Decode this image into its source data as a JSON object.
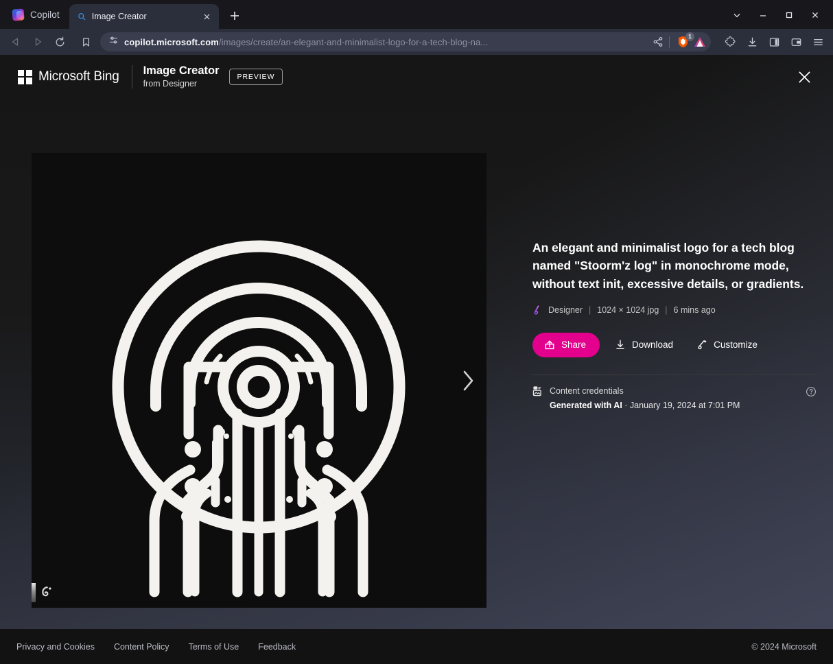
{
  "browser": {
    "brand_tab_label": "Copilot",
    "brand_tab_icon": "copilot-icon",
    "tab": {
      "title": "Image Creator",
      "favicon": "search-icon",
      "close_icon": "close-icon"
    },
    "new_tab_icon": "plus-icon",
    "window_controls": {
      "tab_search_icon": "chevron-down-icon",
      "minimize_icon": "minimize-icon",
      "maximize_icon": "maximize-icon",
      "close_icon": "close-icon"
    },
    "nav": {
      "back_icon": "back-arrow-icon",
      "forward_icon": "forward-arrow-icon",
      "reload_icon": "reload-icon",
      "bookmark_icon": "bookmark-icon"
    },
    "omnibox": {
      "site_settings_icon": "site-settings-icon",
      "url_domain": "copilot.microsoft.com",
      "url_path": "/images/create/an-elegant-and-minimalist-logo-for-a-tech-blog-na...",
      "share_icon": "share-icon",
      "shields_icon": "brave-shields-lion-icon",
      "shields_badge": "1",
      "leo_icon": "brave-leo-triangle-icon"
    },
    "toolbar_right": [
      {
        "name": "extensions-icon"
      },
      {
        "name": "downloads-icon"
      },
      {
        "name": "sidebar-panel-icon"
      },
      {
        "name": "brave-wallet-icon"
      },
      {
        "name": "browser-menu-icon"
      }
    ]
  },
  "site_header": {
    "bing_logo_text": "Microsoft Bing",
    "bing_logo_icon": "microsoft-squares-icon",
    "product_title": "Image Creator",
    "product_subtitle": "from Designer",
    "preview_badge": "PREVIEW",
    "close_icon": "close-icon"
  },
  "image_viewer": {
    "alt": "monochrome circuit tree logo inside a circle",
    "next_icon": "chevron-right-icon",
    "watermark_icon": "designer-watermark-icon"
  },
  "details": {
    "prompt": "An elegant and minimalist logo for a tech blog named \"Stoorm'z log\" in monochrome mode, without text init, excessive details, or gradients.",
    "source_icon": "designer-icon",
    "source": "Designer",
    "separator": "|",
    "dimensions": "1024 × 1024 jpg",
    "timestamp": "6 mins ago",
    "buttons": {
      "share": {
        "label": "Share",
        "icon": "share-arrow-icon",
        "color": "#e3008c"
      },
      "download": {
        "label": "Download",
        "icon": "download-icon"
      },
      "customize": {
        "label": "Customize",
        "icon": "customize-pen-icon"
      }
    },
    "credentials": {
      "icon": "content-credentials-icon",
      "title": "Content credentials",
      "generated_label": "Generated with AI",
      "generated_separator": " · ",
      "generated_date": "January 19, 2024 at 7:01 PM",
      "help_icon": "help-circle-icon"
    }
  },
  "footer": {
    "links": [
      "Privacy and Cookies",
      "Content Policy",
      "Terms of Use",
      "Feedback"
    ],
    "copyright": "© 2024 Microsoft"
  }
}
